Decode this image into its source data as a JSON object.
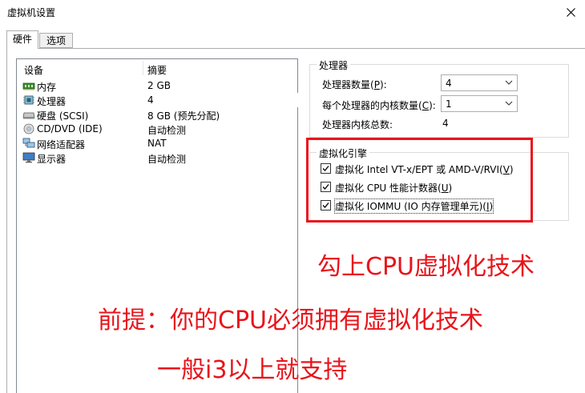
{
  "window": {
    "title": "虚拟机设置"
  },
  "tabs": [
    {
      "label": "硬件",
      "active": true
    },
    {
      "label": "选项",
      "active": false
    }
  ],
  "device_list": {
    "columns": [
      "设备",
      "摘要"
    ],
    "rows": [
      {
        "name": "内存",
        "summary": "2 GB",
        "icon": "memory-icon"
      },
      {
        "name": "处理器",
        "summary": "4",
        "icon": "processor-icon",
        "selected": true
      },
      {
        "name": "硬盘 (SCSI)",
        "summary": "8 GB (预先分配)",
        "icon": "hard-disk-icon"
      },
      {
        "name": "CD/DVD (IDE)",
        "summary": "自动检测",
        "icon": "cd-dvd-icon"
      },
      {
        "name": "网络适配器",
        "summary": "NAT",
        "icon": "network-adapter-icon"
      },
      {
        "name": "显示器",
        "summary": "自动检测",
        "icon": "display-icon"
      }
    ]
  },
  "processor_group": {
    "title": "处理器",
    "count_label_pre": "处理器数量(",
    "count_label_key": "P",
    "count_label_post": "):",
    "count_value": "4",
    "cores_label_pre": "每个处理器的内核数量(",
    "cores_label_key": "C",
    "cores_label_post": "):",
    "cores_value": "1",
    "total_label": "处理器内核总数:",
    "total_value": "4"
  },
  "virtualization_group": {
    "title": "虚拟化引擎",
    "options": [
      {
        "pre": "虚拟化 Intel VT-x/EPT 或 AMD-V/RVI(",
        "key": "V",
        "post": ")",
        "checked": true
      },
      {
        "pre": "虚拟化 CPU 性能计数器(",
        "key": "U",
        "post": ")",
        "checked": true
      },
      {
        "pre": "虚拟化 IOMMU (IO 内存管理单元)(",
        "key": "I",
        "post": ")",
        "checked": true,
        "focused": true
      }
    ]
  },
  "annotations": {
    "line1": "勾上CPU虚拟化技术",
    "line2": "前提：你的CPU必须拥有虚拟化技术",
    "line3": "一般i3以上就支持",
    "color": "#e8141b"
  }
}
